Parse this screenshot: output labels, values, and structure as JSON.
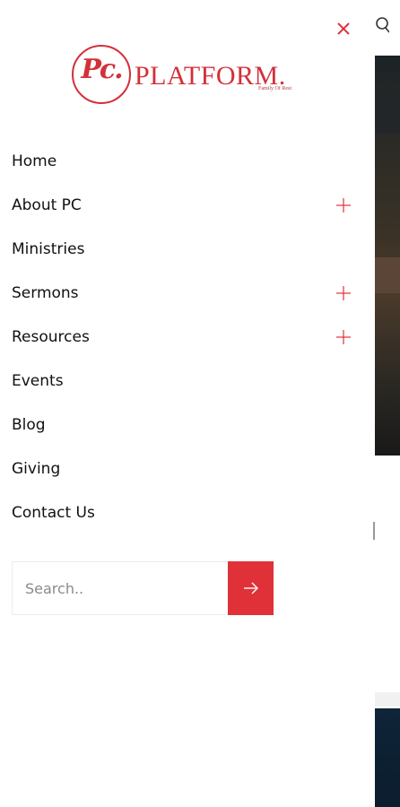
{
  "brand": {
    "monogram": "Pc.",
    "wordmark": "PLATFORM.",
    "tagline": "Family Of Rest",
    "accent_color": "#d3313a"
  },
  "menu": {
    "items": [
      {
        "label": "Home",
        "expandable": false
      },
      {
        "label": "About PC",
        "expandable": true
      },
      {
        "label": "Ministries",
        "expandable": false
      },
      {
        "label": "Sermons",
        "expandable": true
      },
      {
        "label": "Resources",
        "expandable": true
      },
      {
        "label": "Events",
        "expandable": false
      },
      {
        "label": "Blog",
        "expandable": false
      },
      {
        "label": "Giving",
        "expandable": false
      },
      {
        "label": "Contact Us",
        "expandable": false
      }
    ]
  },
  "search": {
    "placeholder": "Search..",
    "value": "",
    "button_color": "#e03139"
  },
  "icons": {
    "close": "close-icon",
    "expand": "plus-icon",
    "submit": "arrow-right-icon",
    "background_search": "search-icon"
  }
}
